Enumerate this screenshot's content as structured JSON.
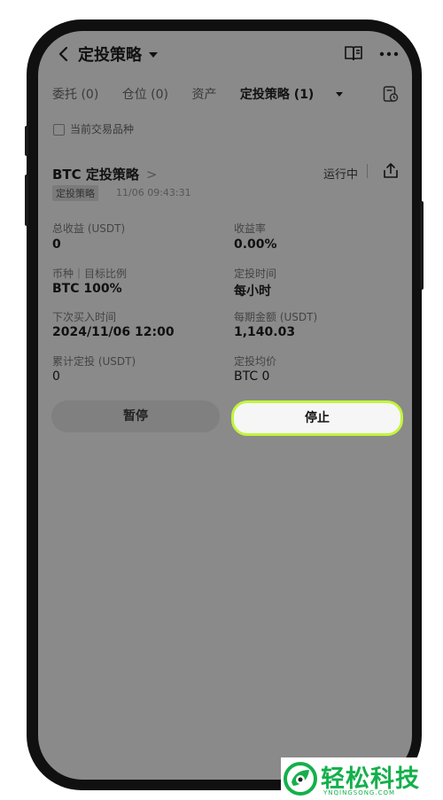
{
  "nav": {
    "title": "定投策略"
  },
  "tabs": [
    {
      "label": "委托 (0)"
    },
    {
      "label": "仓位 (0)"
    },
    {
      "label": "资产"
    },
    {
      "label": "定投策略 (1)"
    }
  ],
  "filter": {
    "label": "当前交易品种"
  },
  "strategy": {
    "title": "BTC 定投策略",
    "status": "运行中",
    "tag": "定投策略",
    "time": "11/06 09:43:31"
  },
  "stats": [
    {
      "label": "总收益 (USDT)",
      "value": "0"
    },
    {
      "label": "收益率",
      "value": "0.00%"
    },
    {
      "label": "币种｜目标比例",
      "value": "BTC 100%"
    },
    {
      "label": "定投时间",
      "value": "每小时"
    },
    {
      "label": "下次买入时间",
      "value": "2024/11/06 12:00"
    },
    {
      "label": "每期金额 (USDT)",
      "value": "1,140.03"
    },
    {
      "label": "累计定投 (USDT)",
      "value": "0"
    },
    {
      "label": "定投均价",
      "value": "BTC 0"
    }
  ],
  "buttons": {
    "pause": "暂停",
    "stop": "停止"
  },
  "watermark": {
    "text": "轻松科技",
    "sub": "YNQINGSONG.COM"
  },
  "colors": {
    "accent": "#c3f53c",
    "brand": "#14b04b"
  }
}
